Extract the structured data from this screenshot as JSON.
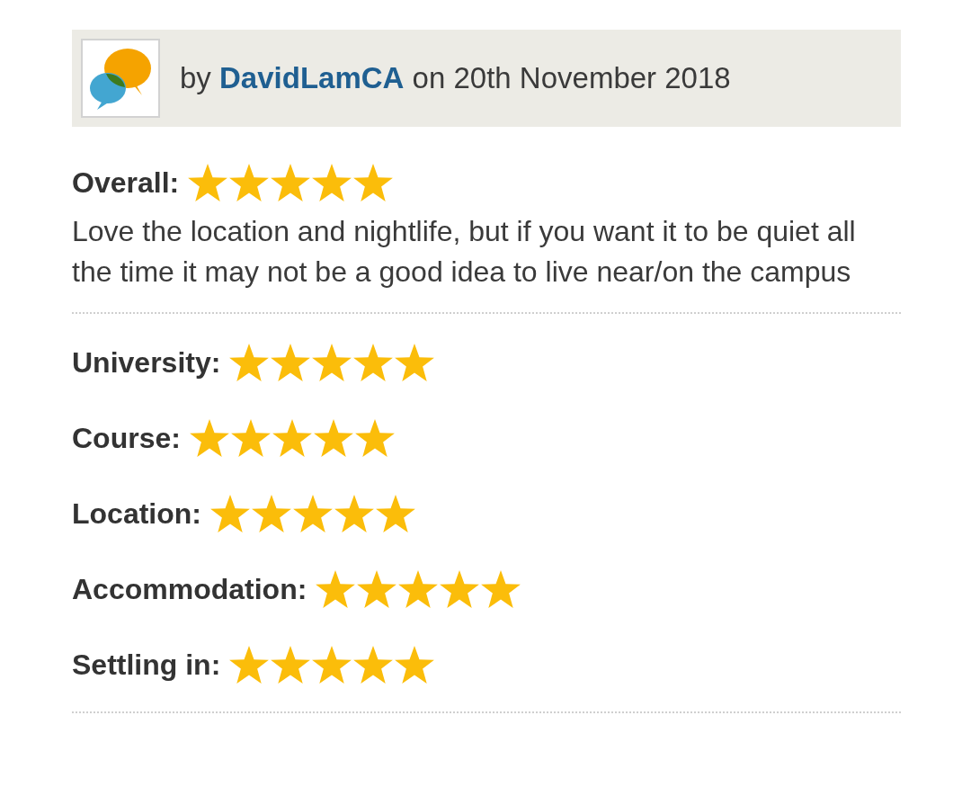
{
  "review_header": {
    "prefix": "by",
    "author": "DavidLamCA",
    "date_text": "on 20th November 2018"
  },
  "overall": {
    "label": "Overall:",
    "stars": 5
  },
  "comment": "Love the location and nightlife, but if you want it to be quiet all the time it may not be a good idea to live near/on the campus",
  "ratings": [
    {
      "label": "University:",
      "stars": 5
    },
    {
      "label": "Course:",
      "stars": 5
    },
    {
      "label": "Location:",
      "stars": 5
    },
    {
      "label": "Accommodation:",
      "stars": 5
    },
    {
      "label": "Settling in:",
      "stars": 5
    }
  ]
}
